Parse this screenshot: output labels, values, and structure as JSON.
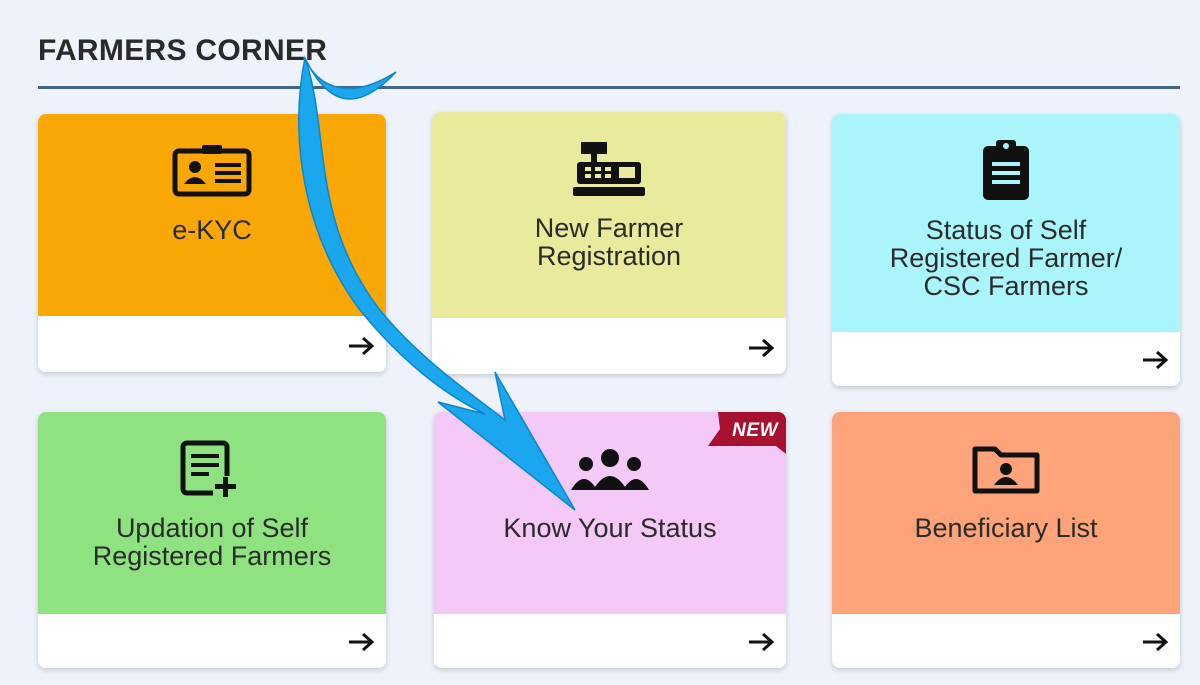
{
  "section": {
    "title": "FARMERS CORNER"
  },
  "cards": [
    {
      "label": "e-KYC",
      "color": "#f9a704",
      "icon": "id-card-icon"
    },
    {
      "label": "New Farmer Registration",
      "color": "#e9ea9b",
      "icon": "cash-register-icon"
    },
    {
      "label": "Status of Self Registered Farmer/ CSC Farmers",
      "color": "#aaf5fb",
      "icon": "clipboard-list-icon"
    },
    {
      "label": "Updation of Self Registered Farmers",
      "color": "#8ee27f",
      "icon": "document-add-icon"
    },
    {
      "label": "Know Your Status",
      "color": "#f4c8f7",
      "icon": "users-group-icon",
      "badge": "NEW"
    },
    {
      "label": "Beneficiary List",
      "color": "#fca37a",
      "icon": "folder-user-icon"
    }
  ],
  "accent": {
    "divider": "#45648a",
    "badge": "#a8102f",
    "overlay_arrow": "#1aa7ee"
  }
}
